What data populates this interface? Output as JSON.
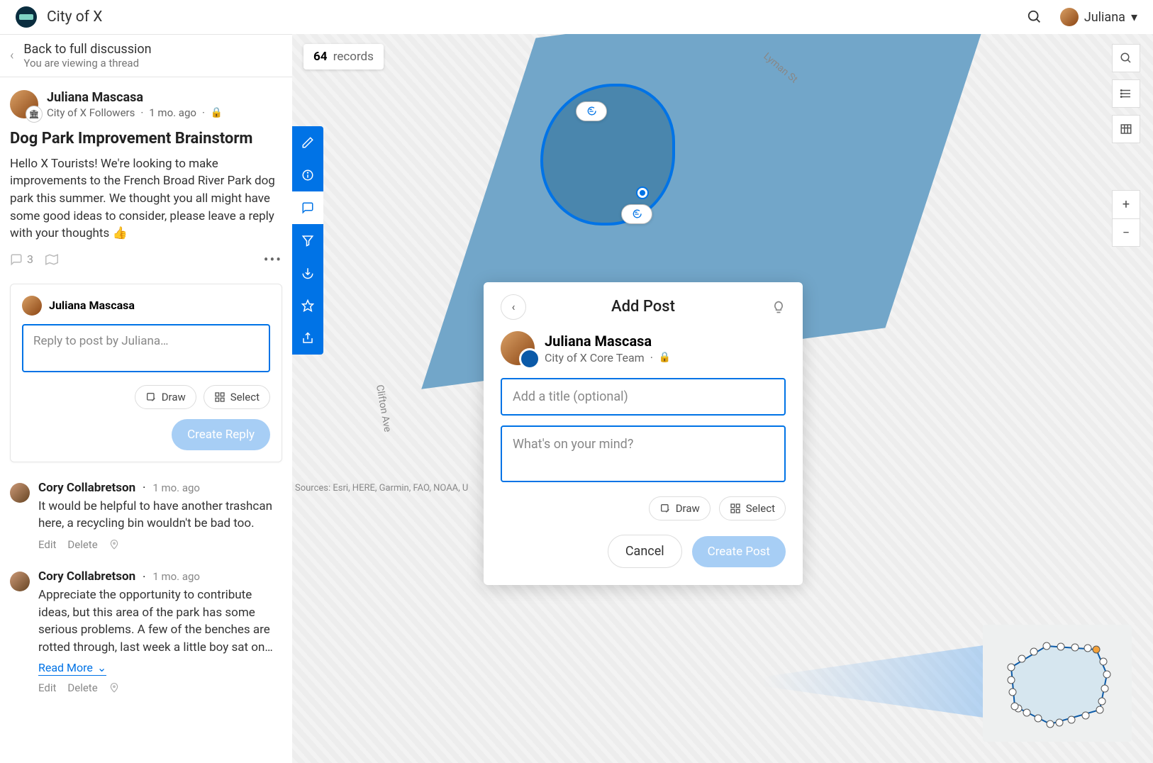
{
  "app": {
    "title": "City of X"
  },
  "user": {
    "name": "Juliana"
  },
  "back": {
    "title": "Back to full discussion",
    "subtitle": "You are viewing a thread"
  },
  "post": {
    "author": "Juliana Mascasa",
    "group": "City of X Followers",
    "time": "1 mo. ago",
    "title": "Dog Park Improvement Brainstorm",
    "body": "Hello X Tourists! We're looking to make improvements to the French Broad River Park dog park this summer. We thought you all might have some good ideas to consider, please leave a reply with your thoughts 👍",
    "comment_count": "3"
  },
  "reply": {
    "author": "Juliana Mascasa",
    "placeholder": "Reply to post by Juliana…",
    "draw": "Draw",
    "select": "Select",
    "submit": "Create Reply"
  },
  "comments": [
    {
      "author": "Cory Collabretson",
      "time": "1 mo. ago",
      "text": "It would be helpful to have another trashcan here, a recycling bin wouldn't be bad too.",
      "edit": "Edit",
      "delete": "Delete"
    },
    {
      "author": "Cory Collabretson",
      "time": "1 mo. ago",
      "text": "Appreciate the opportunity to contribute ideas, but this area of the park has some serious problems. A few of the benches are rotted through, last week a little boy sat on…",
      "read_more": "Read More",
      "edit": "Edit",
      "delete": "Delete"
    }
  ],
  "map": {
    "records_count": "64",
    "records_label": "records",
    "attribution": "Sources: Esri, HERE, Garmin, FAO, NOAA, U",
    "streets": {
      "lyman": "Lyman St",
      "clifton": "Clifton Ave"
    }
  },
  "popup": {
    "title": "Add Post",
    "author": "Juliana Mascasa",
    "group": "City of X Core Team",
    "title_placeholder": "Add a title (optional)",
    "body_placeholder": "What's on your mind?",
    "draw": "Draw",
    "select": "Select",
    "cancel": "Cancel",
    "submit": "Create Post"
  }
}
